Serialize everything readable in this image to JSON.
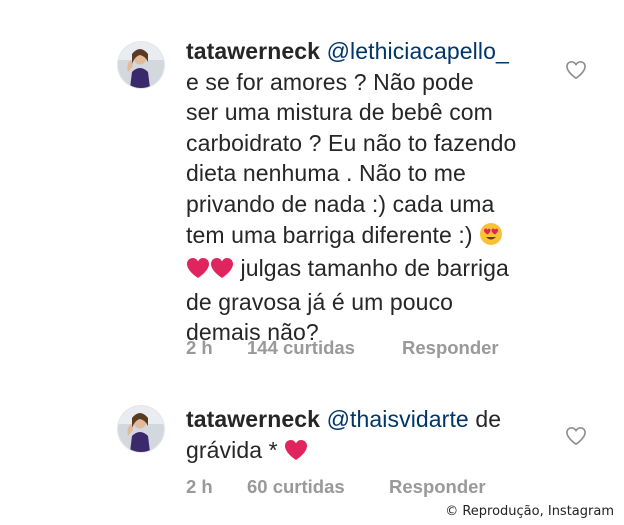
{
  "comments": [
    {
      "username": "tatawerneck",
      "mention": "@lethiciacapello_",
      "line1": "e se for amores ? Não pode",
      "line2": "ser uma mistura de bebê com",
      "line3": "carboidrato ? Eu não to fazendo",
      "line4": "dieta nenhuma . Não to me",
      "line5": "privando de nada :) cada uma",
      "line6": "tem uma barriga diferente :)",
      "line7": "julgas tamanho de barriga",
      "line8": "de gravosa já é um pouco",
      "line9": "demais não?",
      "time": "2 h",
      "likes": "144 curtidas",
      "reply": "Responder"
    },
    {
      "username": "tatawerneck",
      "mention": "@thaisvidarte",
      "line1_tail": "de",
      "line2": "grávida *",
      "time": "2 h",
      "likes": "60 curtidas",
      "reply": "Responder"
    }
  ],
  "credit": "© Reprodução, Instagram",
  "colors": {
    "text": "#262626",
    "meta": "#999999",
    "mention": "#003569",
    "heart_emoji": "#e0245e",
    "avatar_bg": "#c9ced6",
    "avatar_dress": "#3a2a6b"
  },
  "icons": [
    "avatar",
    "heart-outline-icon",
    "heart-eyes-emoji",
    "red-heart-emoji"
  ]
}
